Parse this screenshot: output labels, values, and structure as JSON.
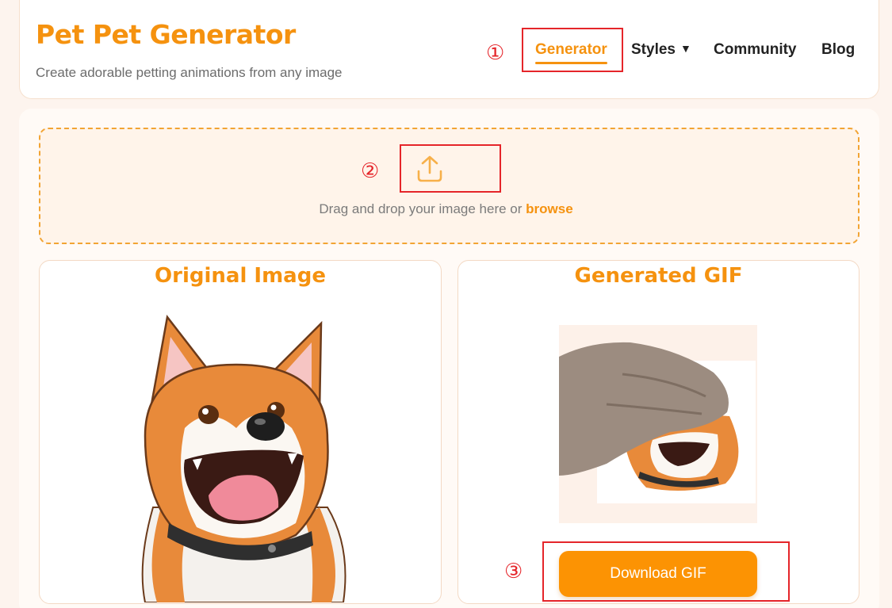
{
  "header": {
    "title": "Pet Pet Generator",
    "subtitle": "Create adorable petting animations from any image"
  },
  "nav": {
    "generator": "Generator",
    "styles": "Styles",
    "styles_caret": "▼",
    "community": "Community",
    "blog": "Blog",
    "active": "Generator"
  },
  "upload": {
    "icon": "upload-icon",
    "text": "Drag and drop your image here or",
    "browse": "browse"
  },
  "panels": {
    "original_title": "Original Image",
    "generated_title": "Generated GIF"
  },
  "actions": {
    "download": "Download GIF"
  },
  "annotations": [
    "①",
    "②",
    "③"
  ],
  "colors": {
    "accent": "#f5920f",
    "button": "#fc9303",
    "annotation": "#e5252a",
    "background": "#fdf4ee"
  }
}
